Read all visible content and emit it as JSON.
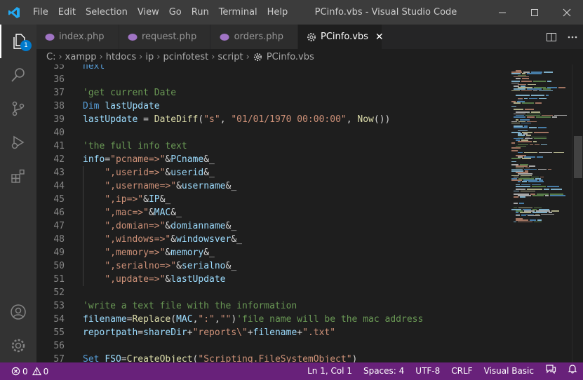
{
  "window": {
    "title": "PCinfo.vbs - Visual Studio Code"
  },
  "menu": [
    "File",
    "Edit",
    "Selection",
    "View",
    "Go",
    "Run",
    "Terminal",
    "Help"
  ],
  "activity": {
    "explorer_badge": "1"
  },
  "tabs": [
    {
      "label": "index.php",
      "dirty": true,
      "active": false
    },
    {
      "label": "request.php",
      "dirty": false,
      "active": false
    },
    {
      "label": "orders.php",
      "dirty": false,
      "active": false
    },
    {
      "label": "PCinfo.vbs",
      "dirty": false,
      "active": true
    }
  ],
  "breadcrumb": [
    "C:",
    "xampp",
    "htdocs",
    "ip",
    "pcinfotest",
    "script",
    "PCinfo.vbs"
  ],
  "code": [
    {
      "n": "35",
      "tokens": [
        [
          "k",
          "next"
        ]
      ]
    },
    {
      "n": "36",
      "tokens": []
    },
    {
      "n": "37",
      "tokens": [
        [
          "c",
          "'get current Date"
        ]
      ]
    },
    {
      "n": "38",
      "tokens": [
        [
          "k",
          "Dim "
        ],
        [
          "i",
          "lastUpdate"
        ]
      ]
    },
    {
      "n": "39",
      "tokens": [
        [
          "i",
          "lastUpdate"
        ],
        [
          "p",
          " = "
        ],
        [
          "f",
          "DateDiff"
        ],
        [
          "p",
          "("
        ],
        [
          "s",
          "\"s\""
        ],
        [
          "p",
          ", "
        ],
        [
          "s",
          "\"01/01/1970 00:00:00\""
        ],
        [
          "p",
          ", "
        ],
        [
          "f",
          "Now"
        ],
        [
          "p",
          "())"
        ]
      ]
    },
    {
      "n": "40",
      "tokens": []
    },
    {
      "n": "41",
      "tokens": [
        [
          "c",
          "'the full info text"
        ]
      ]
    },
    {
      "n": "42",
      "tokens": [
        [
          "i",
          "info"
        ],
        [
          "p",
          "="
        ],
        [
          "s",
          "\"pcname=>\""
        ],
        [
          "p",
          "&"
        ],
        [
          "i",
          "PCname"
        ],
        [
          "p",
          "&_"
        ]
      ]
    },
    {
      "n": "43",
      "tokens": [
        [
          "p",
          "    "
        ],
        [
          "s",
          "\",userid=>\""
        ],
        [
          "p",
          "&"
        ],
        [
          "i",
          "userid"
        ],
        [
          "p",
          "&_"
        ]
      ]
    },
    {
      "n": "44",
      "tokens": [
        [
          "p",
          "    "
        ],
        [
          "s",
          "\",username=>\""
        ],
        [
          "p",
          "&"
        ],
        [
          "i",
          "username"
        ],
        [
          "p",
          "&_"
        ]
      ]
    },
    {
      "n": "45",
      "tokens": [
        [
          "p",
          "    "
        ],
        [
          "s",
          "\",ip=>\""
        ],
        [
          "p",
          "&"
        ],
        [
          "i",
          "IP"
        ],
        [
          "p",
          "&_"
        ]
      ]
    },
    {
      "n": "46",
      "tokens": [
        [
          "p",
          "    "
        ],
        [
          "s",
          "\",mac=>\""
        ],
        [
          "p",
          "&"
        ],
        [
          "i",
          "MAC"
        ],
        [
          "p",
          "&_"
        ]
      ]
    },
    {
      "n": "47",
      "tokens": [
        [
          "p",
          "    "
        ],
        [
          "s",
          "\",domian=>\""
        ],
        [
          "p",
          "&"
        ],
        [
          "i",
          "domianname"
        ],
        [
          "p",
          "&_"
        ]
      ]
    },
    {
      "n": "48",
      "tokens": [
        [
          "p",
          "    "
        ],
        [
          "s",
          "\",windows=>\""
        ],
        [
          "p",
          "&"
        ],
        [
          "i",
          "windowsver"
        ],
        [
          "p",
          "&_"
        ]
      ]
    },
    {
      "n": "49",
      "tokens": [
        [
          "p",
          "    "
        ],
        [
          "s",
          "\",memory=>\""
        ],
        [
          "p",
          "&"
        ],
        [
          "i",
          "memory"
        ],
        [
          "p",
          "&_"
        ]
      ]
    },
    {
      "n": "50",
      "tokens": [
        [
          "p",
          "    "
        ],
        [
          "s",
          "\",serialno=>\""
        ],
        [
          "p",
          "&"
        ],
        [
          "i",
          "serialno"
        ],
        [
          "p",
          "&_"
        ]
      ]
    },
    {
      "n": "51",
      "tokens": [
        [
          "p",
          "    "
        ],
        [
          "s",
          "\",update=>\""
        ],
        [
          "p",
          "&"
        ],
        [
          "i",
          "lastUpdate"
        ]
      ]
    },
    {
      "n": "52",
      "tokens": []
    },
    {
      "n": "53",
      "tokens": [
        [
          "c",
          "'write a text file with the information"
        ]
      ]
    },
    {
      "n": "54",
      "tokens": [
        [
          "i",
          "filename"
        ],
        [
          "p",
          "="
        ],
        [
          "f",
          "Replace"
        ],
        [
          "p",
          "("
        ],
        [
          "i",
          "MAC"
        ],
        [
          "p",
          ","
        ],
        [
          "s",
          "\":\""
        ],
        [
          "p",
          ","
        ],
        [
          "s",
          "\"\""
        ],
        [
          "p",
          ")"
        ],
        [
          "c",
          "'file name will be the mac address"
        ]
      ]
    },
    {
      "n": "55",
      "tokens": [
        [
          "i",
          "reportpath"
        ],
        [
          "p",
          "="
        ],
        [
          "i",
          "shareDir"
        ],
        [
          "p",
          "+"
        ],
        [
          "s",
          "\"reports\\\""
        ],
        [
          "p",
          "+"
        ],
        [
          "i",
          "filename"
        ],
        [
          "p",
          "+"
        ],
        [
          "s",
          "\".txt\""
        ]
      ]
    },
    {
      "n": "56",
      "tokens": []
    },
    {
      "n": "57",
      "tokens": [
        [
          "k",
          "Set "
        ],
        [
          "i",
          "FSO"
        ],
        [
          "p",
          "="
        ],
        [
          "f",
          "CreateObject"
        ],
        [
          "p",
          "("
        ],
        [
          "s",
          "\"Scripting.FileSystemObject\""
        ],
        [
          "p",
          ")"
        ]
      ]
    }
  ],
  "status": {
    "errors": "0",
    "warnings": "0",
    "position": "Ln 1, Col 1",
    "spaces": "Spaces: 4",
    "encoding": "UTF-8",
    "eol": "CRLF",
    "language": "Visual Basic"
  },
  "colors": {
    "statusbar": "#68217a",
    "keyword": "#569cd6",
    "string": "#ce9178",
    "comment": "#6a9955",
    "identifier": "#9cdcfe",
    "function": "#dcdcaa",
    "vscode_logo": "#23a9f2",
    "php_icon": "#a074c4"
  }
}
